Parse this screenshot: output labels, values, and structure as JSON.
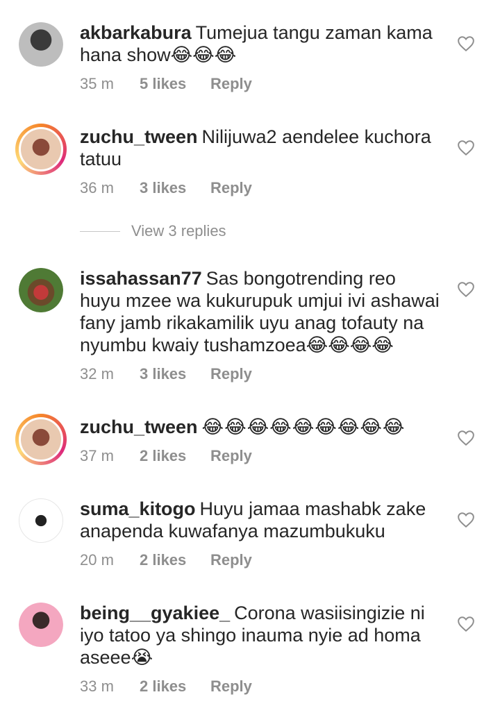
{
  "comments": [
    {
      "username": "akbarkabura",
      "text": "Tumejua tangu zaman kama hana show😂😂😂",
      "time": "35 m",
      "likes": "5 likes",
      "reply": "Reply",
      "avatar_colors": [
        "#bdbdbd",
        "#3a3a3a"
      ],
      "story_ring": false
    },
    {
      "username": "zuchu_tween",
      "text": "Nilijuwa2 aendelee kuchora tatuu",
      "time": "36 m",
      "likes": "3 likes",
      "reply": "Reply",
      "avatar_colors": [
        "#e9c9b0",
        "#8a4a3a"
      ],
      "story_ring": true
    },
    {
      "username": "issahassan77",
      "text": "Sas bongotrending reo huyu mzee wa kukurupuk umjui ivi ashawai fany jamb rikakamilik uyu anag tofauty na nyumbu kwaiy tushamzoea😂😂😂😂",
      "time": "32 m",
      "likes": "3 likes",
      "reply": "Reply",
      "avatar_colors": [
        "#4f7a35",
        "#c23a3a"
      ],
      "story_ring": false
    },
    {
      "username": "zuchu_tween",
      "text": "😂😂😂😂😂😂😂😂😂",
      "time": "37 m",
      "likes": "2 likes",
      "reply": "Reply",
      "avatar_colors": [
        "#e9c9b0",
        "#8a4a3a"
      ],
      "story_ring": true
    },
    {
      "username": "suma_kitogo",
      "text": "Huyu jamaa mashabk zake anapenda kuwafanya mazumbukuku",
      "time": "20 m",
      "likes": "2 likes",
      "reply": "Reply",
      "avatar_colors": [
        "#ffffff",
        "#222222"
      ],
      "story_ring": false
    },
    {
      "username": "being__gyakiee_",
      "text": "Corona wasiisingizie ni iyo tatoo ya shingo inauma nyie ad homa aseee😭",
      "time": "33 m",
      "likes": "2 likes",
      "reply": "Reply",
      "avatar_colors": [
        "#f4a7c0",
        "#3a2a2a"
      ],
      "story_ring": false
    }
  ],
  "view_replies": "View 3 replies",
  "colors": {
    "text": "#262626",
    "meta": "#8e8e8e",
    "background": "#ffffff"
  },
  "icons": {
    "like": "heart-outline-icon"
  }
}
